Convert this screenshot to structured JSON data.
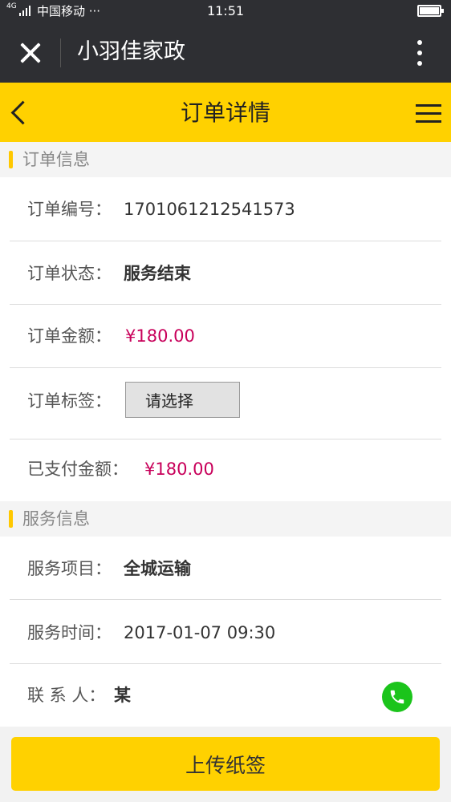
{
  "status_bar": {
    "network": "4G",
    "carrier": "中国移动 ···",
    "time": "11:51"
  },
  "wechat_bar": {
    "title": "小羽佳家政"
  },
  "header": {
    "title": "订单详情"
  },
  "order_info": {
    "section_title": "订单信息",
    "order_no_label": "订单编号：",
    "order_no": "1701061212541573",
    "status_label": "订单状态：",
    "status": "服务结束",
    "amount_label": "订单金额：",
    "amount": "¥180.00",
    "tag_label": "订单标签：",
    "tag_select": "请选择",
    "paid_label": "已支付金额：",
    "paid": "¥180.00"
  },
  "service_info": {
    "section_title": "服务信息",
    "item_label": "服务项目：",
    "item": "全城运输",
    "time_label": "服务时间：",
    "time": "2017-01-07 09:30",
    "contact_label": "联 系 人：",
    "contact": "某"
  },
  "actions": {
    "upload": "上传纸签"
  },
  "colors": {
    "accent": "#ffd100",
    "money": "#c8005a",
    "phone": "#1bc41b",
    "dark_bar": "#2e2f33"
  }
}
